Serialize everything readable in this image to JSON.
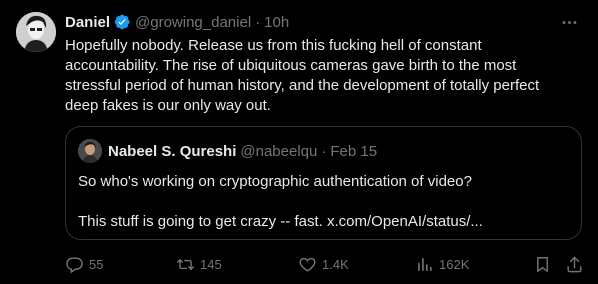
{
  "tweet": {
    "author": {
      "name": "Daniel",
      "handle": "@growing_daniel",
      "time": "10h",
      "separator": "·",
      "verified": true,
      "verified_color": "#1d9bf0"
    },
    "text": "Hopefully nobody. Release us from this fucking hell of constant accountability. The rise of ubiquitous cameras gave birth to the most stressful period of human history, and the development of totally perfect deep fakes is our only way out.",
    "more_icon": "more-horizontal-icon"
  },
  "quote": {
    "author": {
      "name": "Nabeel S. Qureshi",
      "handle": "@nabeelqu",
      "time": "Feb 15",
      "separator": "·"
    },
    "line1": "So who's working on cryptographic authentication of video?",
    "line2": "This stuff is going to get crazy -- fast. x.com/OpenAI/status/..."
  },
  "actions": {
    "reply": {
      "icon": "reply-icon",
      "count": "55"
    },
    "retweet": {
      "icon": "retweet-icon",
      "count": "145"
    },
    "like": {
      "icon": "heart-icon",
      "count": "1.4K"
    },
    "views": {
      "icon": "views-chart-icon",
      "count": "162K"
    },
    "bookmark": {
      "icon": "bookmark-icon"
    },
    "share": {
      "icon": "share-icon"
    }
  },
  "colors": {
    "background": "#000000",
    "text": "#e7e9ea",
    "muted": "#71767b",
    "border": "#2f3336"
  }
}
